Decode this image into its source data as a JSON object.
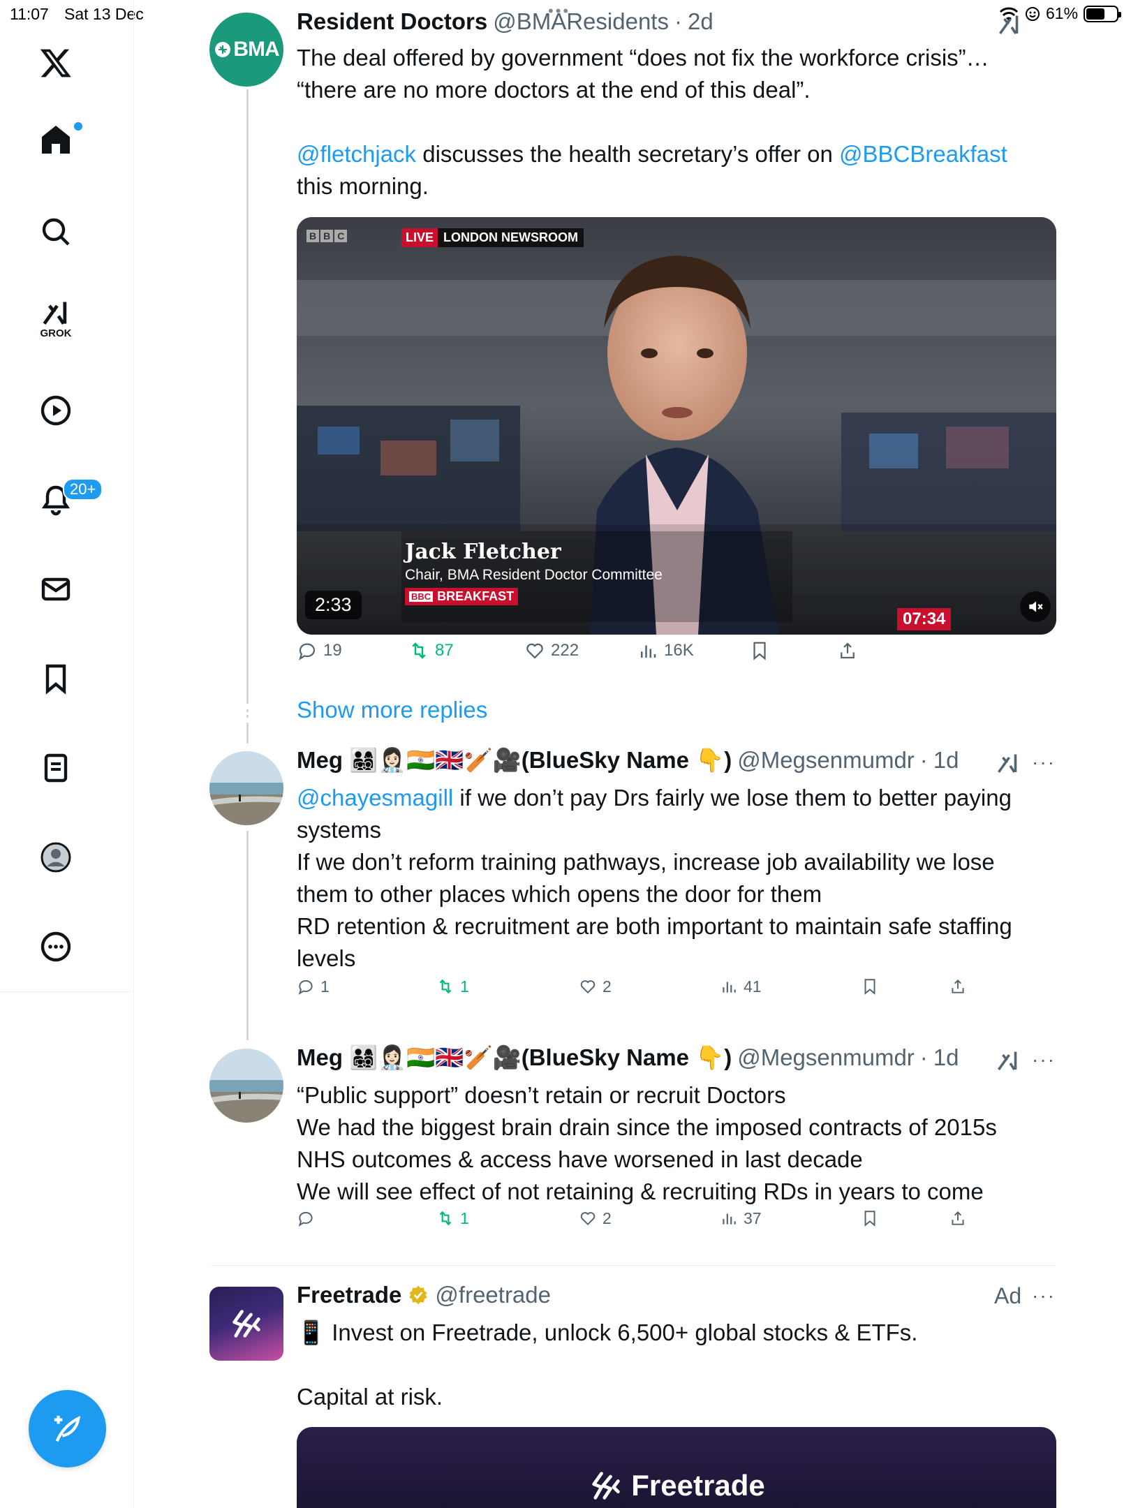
{
  "status_bar": {
    "time": "11:07",
    "date": "Sat 13 Dec",
    "battery": "61%",
    "battery_level": 0.61
  },
  "sidebar": {
    "notifications_badge": "20+",
    "grok_label": "GROK"
  },
  "thread": [
    {
      "avatar_text": "BMA",
      "name": "Resident Doctors",
      "handle": "@BMAResidents",
      "time": "2d",
      "text_lines": [
        "The deal offered by government “does not fix the workforce crisis”…",
        "“there are no more doctors at the end of this deal”."
      ],
      "mention1": "@fletchjack",
      "text_mid": " discusses the health secretary’s offer on ",
      "mention2": "@BBCBreakfast",
      "text_end": "this morning.",
      "video": {
        "live_label": "LIVE",
        "live_location": "LONDON NEWSROOM",
        "channel_logo": "BBC",
        "person_name": "Jack Fletcher",
        "person_title": "Chair, BMA Resident Doctor Committee",
        "program": "BREAKFAST",
        "clock": "07:34",
        "duration": "2:33"
      },
      "stats": {
        "replies": "19",
        "retweets": "87",
        "likes": "222",
        "views": "16K"
      }
    }
  ],
  "show_more_replies": "Show more replies",
  "replies": [
    {
      "name": "Meg 👨‍👩‍👧‍👦👩🏻‍⚕️🇮🇳🇬🇧🏏🎥(BlueSky Name 👇)",
      "handle": "@Megsenmumdr",
      "time": "1d",
      "mention": "@chayesmagill",
      "text_first": " if we don’t pay Drs fairly we lose them to better paying systems",
      "text_lines": [
        "If we don’t reform training pathways, increase job availability we lose them to other places which opens the door for them",
        "RD retention & recruitment are both important to maintain safe staffing levels"
      ],
      "stats": {
        "replies": "1",
        "retweets": "1",
        "likes": "2",
        "views": "41"
      }
    },
    {
      "name": "Meg 👨‍👩‍👧‍👦👩🏻‍⚕️🇮🇳🇬🇧🏏🎥(BlueSky Name 👇)",
      "handle": "@Megsenmumdr",
      "time": "1d",
      "text_lines": [
        "“Public support” doesn’t retain or recruit Doctors",
        "We had the biggest brain drain since the imposed contracts of 2015s",
        "NHS outcomes & access have worsened in last decade",
        "We will see effect of not retaining & recruiting RDs in years to come"
      ],
      "stats": {
        "replies": "",
        "retweets": "1",
        "likes": "2",
        "views": "37"
      }
    }
  ],
  "ad": {
    "name": "Freetrade",
    "handle": "@freetrade",
    "ad_label": "Ad",
    "text_line1": "📱 Invest on Freetrade, unlock 6,500+ global stocks & ETFs.",
    "text_line2": "Capital at risk.",
    "banner_brand": "Freetrade"
  },
  "colors": {
    "accent": "#1d9bf0",
    "retweet": "#00ba7c",
    "bma_green": "#1a9a7a",
    "bbc_red": "#c8102e"
  }
}
